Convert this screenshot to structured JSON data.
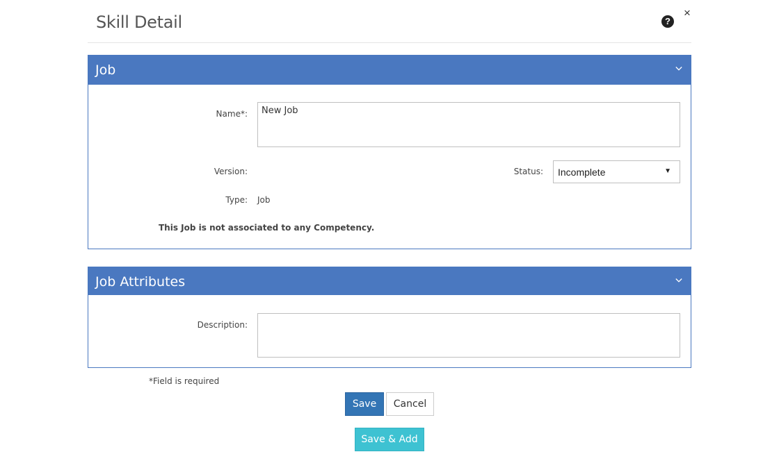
{
  "modal": {
    "title": "Skill Detail",
    "help_icon_glyph": "?",
    "close_icon_glyph": "×"
  },
  "job_panel": {
    "title": "Job",
    "name_label": "Name*:",
    "name_value": "New Job",
    "version_label": "Version:",
    "version_value": "",
    "status_label": "Status:",
    "status_value": "Incomplete",
    "type_label": "Type:",
    "type_value": "Job",
    "competency_note": "This Job is not associated to any Competency."
  },
  "attributes_panel": {
    "title": "Job Attributes",
    "description_label": "Description:",
    "description_value": ""
  },
  "footer": {
    "required_note": "*Field is required",
    "save_label": "Save",
    "cancel_label": "Cancel",
    "save_add_label": "Save & Add"
  },
  "colors": {
    "panel_header": "#4a78c0",
    "save_button": "#3375b5",
    "save_add_button": "#3ec2d2"
  },
  "icons": {
    "help": "question-circle-icon",
    "close": "close-icon",
    "collapse": "chevron-down-icon",
    "select_arrow": "caret-down-icon"
  }
}
